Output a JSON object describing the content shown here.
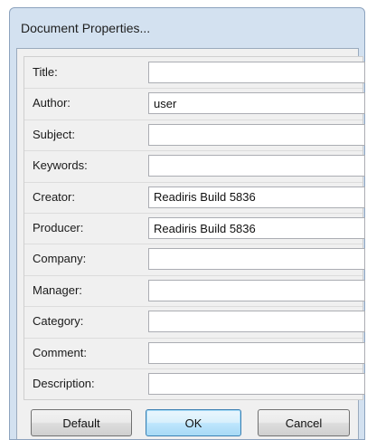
{
  "window": {
    "title": "Document Properties..."
  },
  "fields": [
    {
      "label": "Title:",
      "value": ""
    },
    {
      "label": "Author:",
      "value": "user"
    },
    {
      "label": "Subject:",
      "value": ""
    },
    {
      "label": "Keywords:",
      "value": ""
    },
    {
      "label": "Creator:",
      "value": "Readiris Build 5836"
    },
    {
      "label": "Producer:",
      "value": "Readiris Build 5836"
    },
    {
      "label": "Company:",
      "value": ""
    },
    {
      "label": "Manager:",
      "value": ""
    },
    {
      "label": "Category:",
      "value": ""
    },
    {
      "label": "Comment:",
      "value": ""
    },
    {
      "label": "Description:",
      "value": ""
    }
  ],
  "buttons": {
    "default_label": "Default",
    "ok_label": "OK",
    "cancel_label": "Cancel"
  }
}
